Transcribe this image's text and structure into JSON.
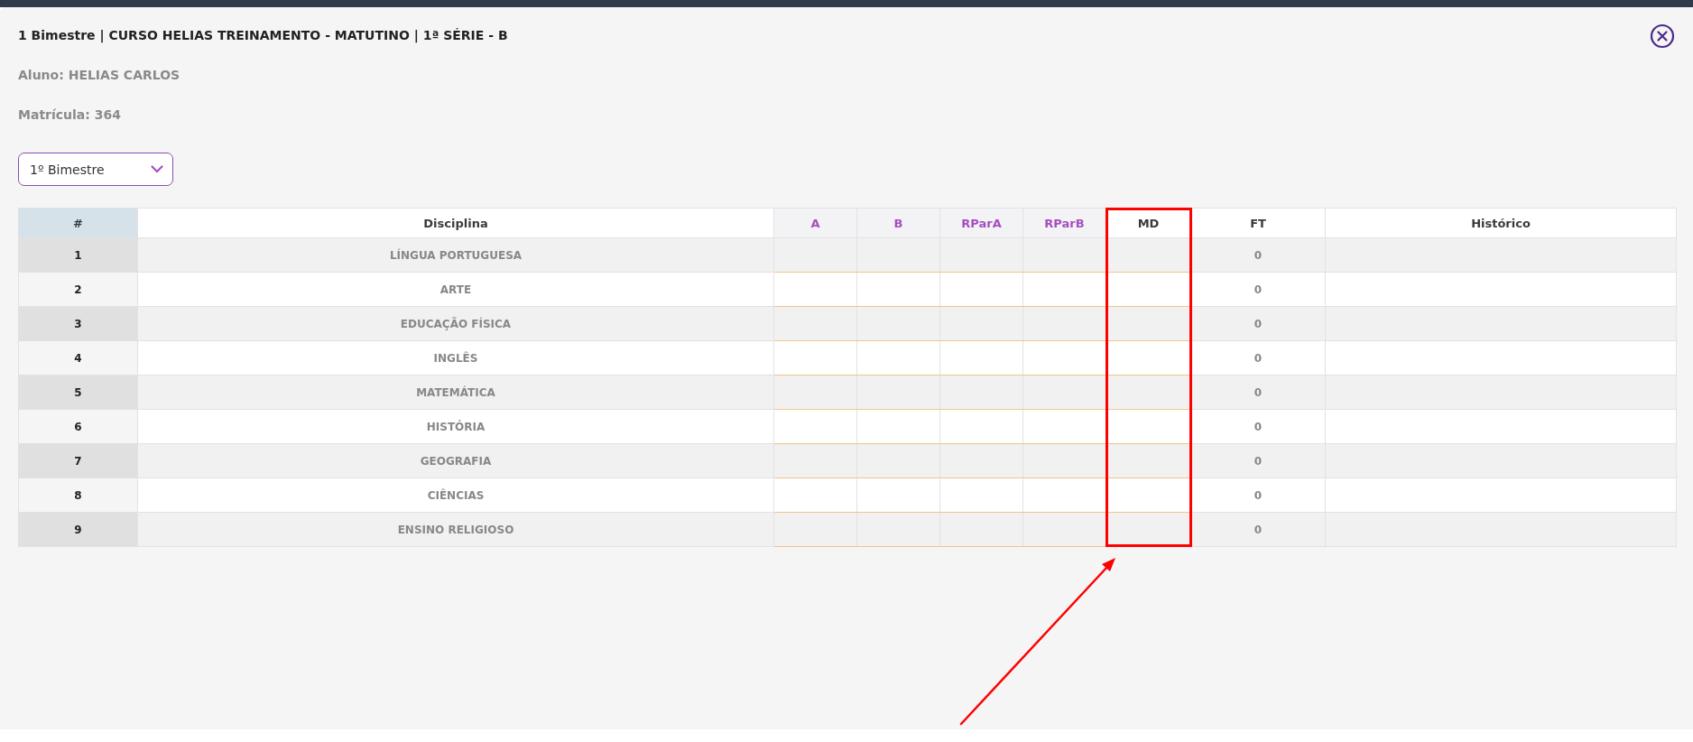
{
  "modal": {
    "title": "1 Bimestre | CURSO HELIAS TREINAMENTO - MATUTINO | 1ª SÉRIE - B",
    "student": "Aluno: HELIAS CARLOS",
    "enrollment": "Matrícula: 364",
    "period_select": {
      "value": "1º Bimestre"
    }
  },
  "table": {
    "columns": [
      {
        "label": "#",
        "kind": "index",
        "highlighted": false
      },
      {
        "label": "Disciplina",
        "kind": "subject",
        "highlighted": false
      },
      {
        "label": "A",
        "kind": "grade",
        "highlighted": false
      },
      {
        "label": "B",
        "kind": "grade",
        "highlighted": false
      },
      {
        "label": "RParA",
        "kind": "grade",
        "highlighted": false
      },
      {
        "label": "RParB",
        "kind": "grade",
        "highlighted": false
      },
      {
        "label": "MD",
        "kind": "average",
        "highlighted": true
      },
      {
        "label": "FT",
        "kind": "count",
        "highlighted": false
      },
      {
        "label": "Histórico",
        "kind": "text",
        "highlighted": false
      }
    ],
    "rows": [
      {
        "number": "1",
        "subject": "LÍNGUA PORTUGUESA",
        "absences": "0"
      },
      {
        "number": "2",
        "subject": "ARTE",
        "absences": "0"
      },
      {
        "number": "3",
        "subject": "EDUCAÇÃO FÍSICA",
        "absences": "0"
      },
      {
        "number": "4",
        "subject": "INGLÊS",
        "absences": "0"
      },
      {
        "number": "5",
        "subject": "MATEMÁTICA",
        "absences": "0"
      },
      {
        "number": "6",
        "subject": "HISTÓRIA",
        "absences": "0"
      },
      {
        "number": "7",
        "subject": "GEOGRAFIA",
        "absences": "0"
      },
      {
        "number": "8",
        "subject": "CIÊNCIAS",
        "absences": "0"
      },
      {
        "number": "9",
        "subject": "ENSINO RELIGIOSO",
        "absences": "0"
      }
    ]
  }
}
